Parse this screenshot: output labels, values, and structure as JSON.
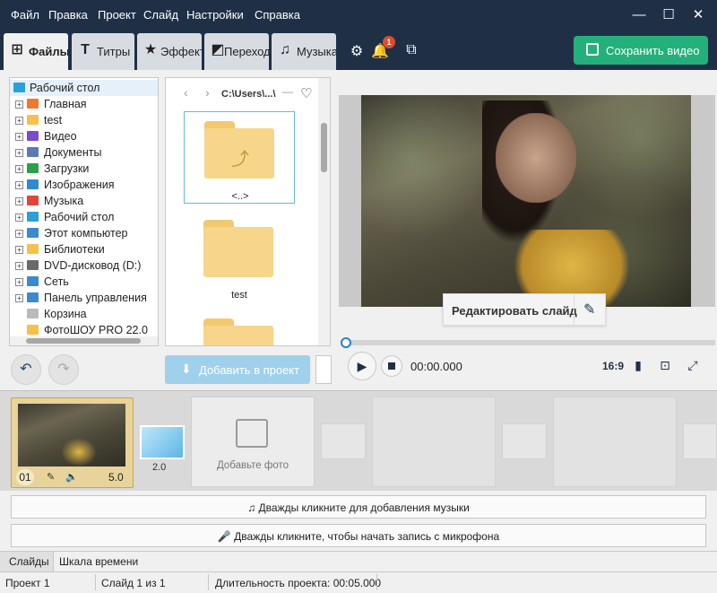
{
  "menu": [
    "Файл",
    "Правка",
    "Проект",
    "Слайд",
    "Настройки",
    "Справка"
  ],
  "tabs": [
    {
      "label": "Файлы",
      "icon": "add-file-icon"
    },
    {
      "label": "Титры",
      "icon": "text-icon"
    },
    {
      "label": "Эффекты",
      "icon": "star-icon"
    },
    {
      "label": "Переходы",
      "icon": "transition-icon"
    },
    {
      "label": "Музыка",
      "icon": "music-icon"
    }
  ],
  "notification_count": "1",
  "save_button": "Сохранить видео",
  "tree": {
    "root": "Рабочий стол",
    "items": [
      "Главная",
      "test",
      "Видео",
      "Документы",
      "Загрузки",
      "Изображения",
      "Музыка",
      "Рабочий стол",
      "Этот компьютер",
      "Библиотеки",
      "DVD-дисковод (D:)",
      "Сеть",
      "Панель управления",
      "Корзина",
      "ФотоШОУ PRO 22.0"
    ]
  },
  "file_browser": {
    "path": "C:\\Users\\...\\",
    "folders": [
      "<..>",
      "test",
      ""
    ]
  },
  "add_to_project": "Добавить в проект",
  "preview": {
    "edit_slide": "Редактировать слайд",
    "time": "00:00.000",
    "aspect_ratio": "16:9",
    "progress": 0
  },
  "timeline": {
    "slide_number": "01",
    "slide_duration": "5.0",
    "transition_duration": "2.0",
    "add_photo": "Добавьте фото"
  },
  "music_bar": "Дважды кликните для добавления музыки",
  "mic_bar": "Дважды кликните, чтобы начать запись с микрофона",
  "bottom_tabs": [
    "Слайды",
    "Шкала времени"
  ],
  "status": {
    "project": "Проект 1",
    "slide": "Слайд 1 из 1",
    "duration": "Длительность проекта: 00:05.000"
  },
  "colors": {
    "header": "#1f3046",
    "save_green": "#24b07a",
    "accent_blue": "#2b80c8",
    "slide_selected": "#e8d39a"
  }
}
